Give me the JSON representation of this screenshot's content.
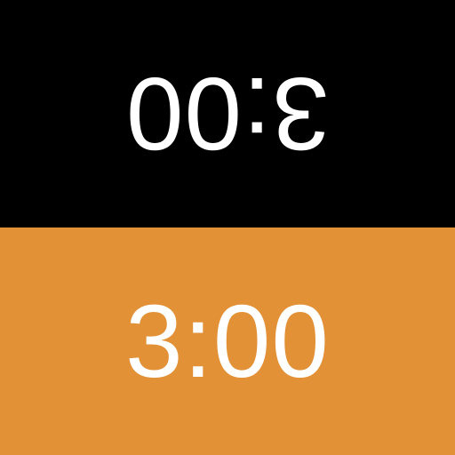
{
  "top_player": {
    "time": "3:00",
    "background_color": "#000000",
    "text_color": "#FFFFFF",
    "orientation": "rotated-180"
  },
  "bottom_player": {
    "time": "3:00",
    "background_color": "#E39137",
    "text_color": "#FFFFFF",
    "orientation": "upright"
  }
}
